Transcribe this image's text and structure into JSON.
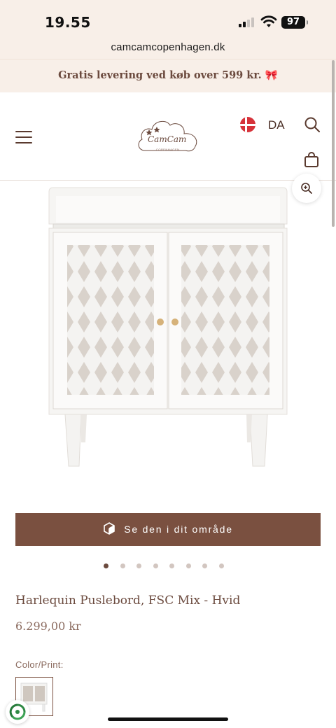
{
  "status_bar": {
    "time": "19.55",
    "battery": "97"
  },
  "browser": {
    "url": "camcamcopenhagen.dk"
  },
  "promo": {
    "text": "Gratis levering ved køb over 599 kr.",
    "emoji": "🎀"
  },
  "header": {
    "logo_text": "CamCam",
    "logo_sub": "COPENHAGEN",
    "language": "DA",
    "icons": [
      "menu-icon",
      "denmark-flag-icon",
      "search-icon",
      "bag-icon"
    ]
  },
  "product": {
    "cta_label": "Se den i dit område",
    "gallery_count": 8,
    "gallery_active": 1,
    "title": "Harlequin Puslebord, FSC Mix - Hvid",
    "price": "6.299,00 kr",
    "color_label": "Color/Print:"
  },
  "colors": {
    "brand_brown": "#7a5040",
    "promo_bg": "#f8efe8",
    "text_brown": "#6b4a3e"
  }
}
